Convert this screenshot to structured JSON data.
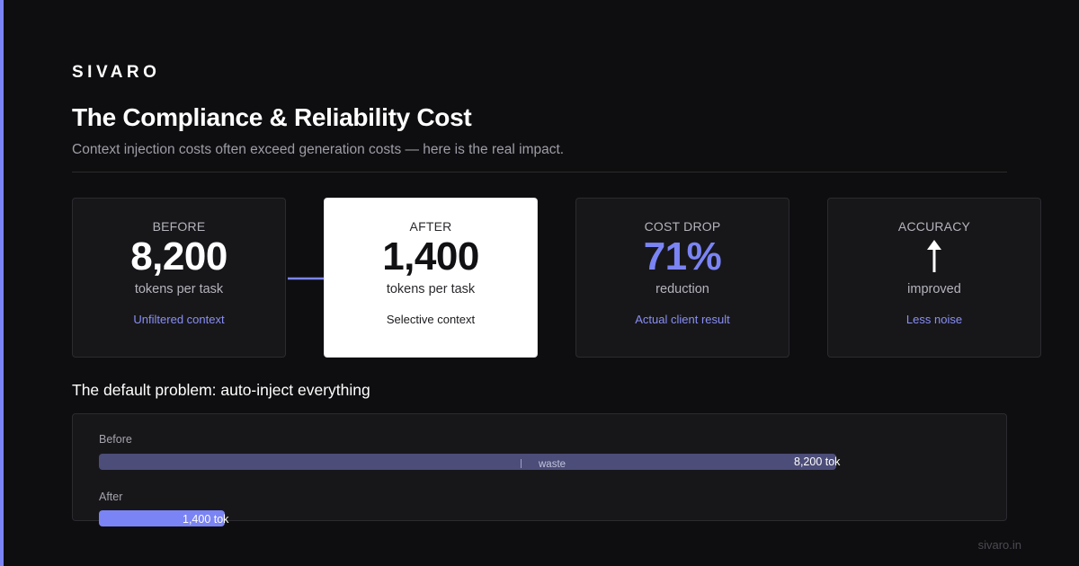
{
  "brand": "SIVARO",
  "title": "The Compliance & Reliability Cost",
  "subtitle": "Context injection costs often exceed generation costs — here is the real impact.",
  "cards": [
    {
      "caption": "BEFORE",
      "value": "8,200",
      "unit": "tokens per task",
      "note": "Unfiltered context"
    },
    {
      "caption": "AFTER",
      "value": "1,400",
      "unit": "tokens per task",
      "note": "Selective context"
    },
    {
      "caption": "COST DROP",
      "value": "71%",
      "unit": "reduction",
      "note": "Actual client result"
    },
    {
      "caption": "ACCURACY",
      "icon": "up-arrow-icon",
      "unit": "improved",
      "note": "Less noise"
    }
  ],
  "section_title": "The default problem: auto-inject everything",
  "token_bars": {
    "max_tokens": 8200,
    "before": {
      "label": "Before",
      "tokens": 8200,
      "value_label": "8,200 tok",
      "waste_label": "waste"
    },
    "after": {
      "label": "After",
      "tokens": 1400,
      "value_label": "1,400 tok"
    }
  },
  "colors": {
    "accent": "#7b84f4",
    "background": "#0e0e10",
    "card": "#17171a",
    "before_bar": "#4c4d78"
  },
  "footer": "sivaro.in"
}
